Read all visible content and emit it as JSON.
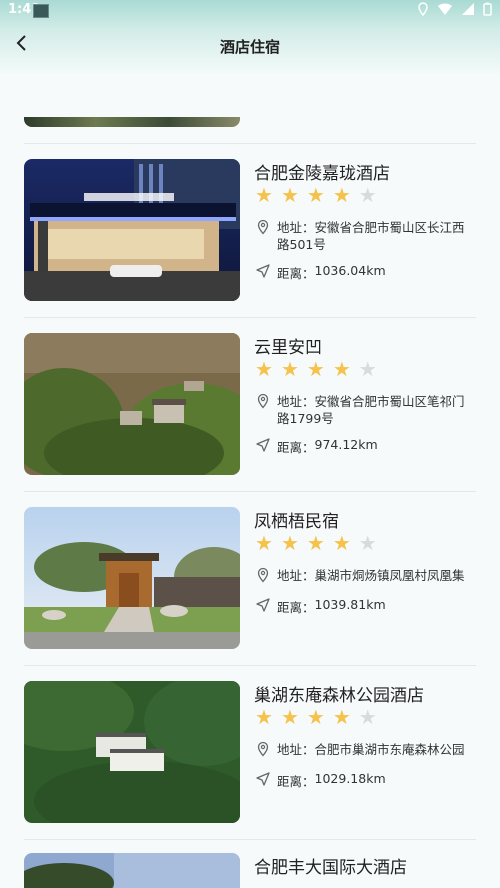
{
  "status": {
    "time": "1:41"
  },
  "header": {
    "title": "酒店住宿"
  },
  "hotels": [
    {
      "name": "合肥金陵嘉珑酒店",
      "rating": 4,
      "address_label": "地址：",
      "address": "安徽省合肥市蜀山区长江西路501号",
      "distance_label": "距离：",
      "distance": "1036.04km"
    },
    {
      "name": "云里安凹",
      "rating": 4,
      "address_label": "地址：",
      "address": "安徽省合肥市蜀山区笔祁门路1799号",
      "distance_label": "距离：",
      "distance": "974.12km"
    },
    {
      "name": "凤栖梧民宿",
      "rating": 4,
      "address_label": "地址：",
      "address": "巢湖市烔炀镇凤凰村凤凰集",
      "distance_label": "距离：",
      "distance": "1039.81km"
    },
    {
      "name": "巢湖东庵森林公园酒店",
      "rating": 4,
      "address_label": "地址：",
      "address": "合肥市巢湖市东庵森林公园",
      "distance_label": "距离：",
      "distance": "1029.18km"
    },
    {
      "name": "合肥丰大国际大酒店"
    }
  ],
  "icons": {
    "back": "back-arrow-icon",
    "address": "location-pin-icon",
    "distance": "navigation-arrow-icon"
  },
  "colors": {
    "star_on": "#f5c24b",
    "star_off": "#d8dbde",
    "header_tint": "#a9dad3"
  }
}
